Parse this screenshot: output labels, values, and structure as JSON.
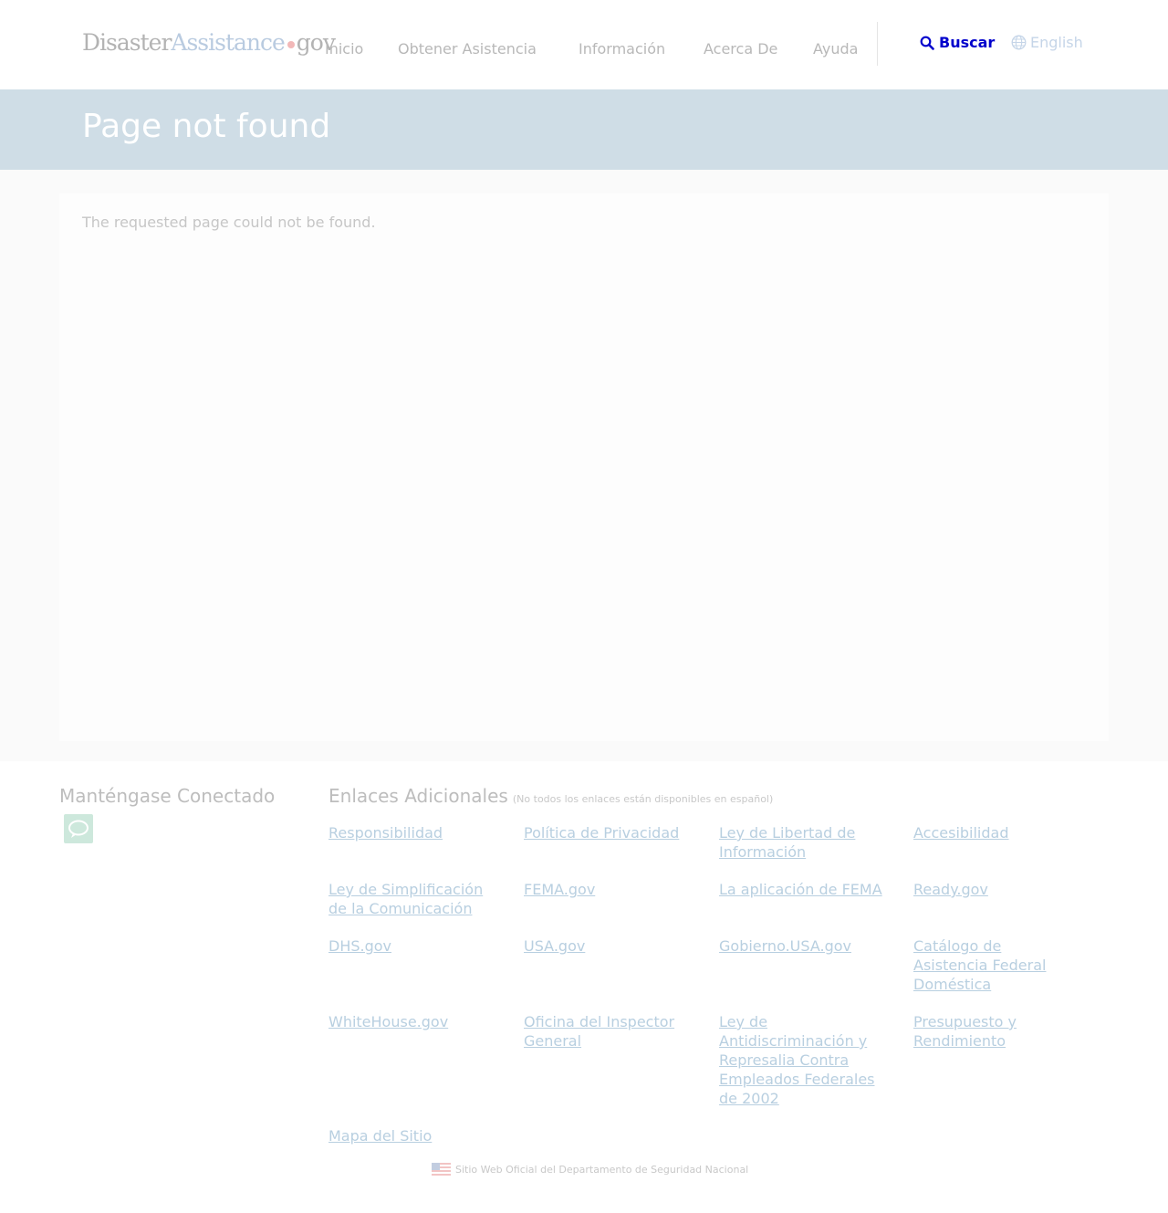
{
  "logo": {
    "part1": "Disaster",
    "part2": "Assistance",
    "part3": "gov"
  },
  "nav": [
    "Inicio",
    "Obtener Asistencia",
    "Información",
    "Acerca De",
    "Ayuda"
  ],
  "search_label": "Buscar",
  "language_label": "English",
  "page_title": "Page not found",
  "message": "The requested page could not be found.",
  "footer": {
    "connect_title": "Manténgase Conectado",
    "links_title": "Enlaces Adicionales",
    "links_note": "(No todos los enlaces están disponibles en español)",
    "links": [
      "Responsibilidad",
      "Política de Privacidad",
      "Ley de Libertad de Información",
      "Accesibilidad",
      "Ley de Simplificación de la Comunicación",
      "FEMA.gov",
      "La aplicación de FEMA",
      "Ready.gov",
      "DHS.gov",
      "USA.gov",
      "Gobierno.USA.gov",
      "Catálogo de Asistencia Federal Doméstica",
      "WhiteHouse.gov",
      "Oficina del Inspector General",
      "Ley de Antidiscriminación y Represalia Contra Empleados Federales de 2002",
      "Presupuesto y Rendimiento",
      "Mapa del Sitio"
    ],
    "official_text": "Sitio Web Oficial del Departamento de Seguridad Nacional"
  },
  "colors": {
    "search": "#0000cc",
    "banner": "#cfdde6",
    "link": "#b8cfe0"
  }
}
